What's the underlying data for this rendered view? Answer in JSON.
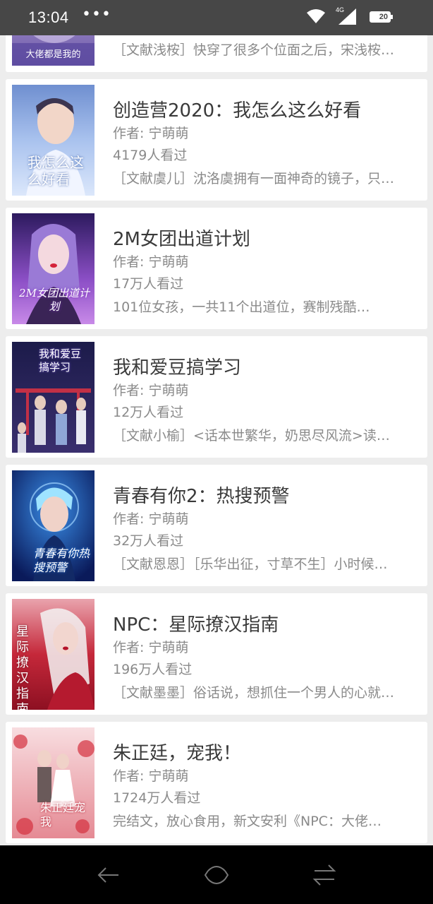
{
  "status_bar": {
    "time": "13:04",
    "dots": "•••",
    "network": "4G",
    "battery": "20"
  },
  "books": [
    {
      "cover_text": "大佬都是我的",
      "title": "",
      "author": "",
      "views": "",
      "desc": "［文献浅桉］快穿了很多个位面之后，宋浅桉…"
    },
    {
      "cover_text": "我怎么这么好看",
      "title": "创造营2020：我怎么这么好看",
      "author": "作者: 宁萌萌",
      "views": "4179人看过",
      "desc": "［文献虞儿］沈洛虞拥有一面神奇的镜子，只…"
    },
    {
      "cover_text": "2M女团出道计划",
      "title": "2M女团出道计划",
      "author": "作者: 宁萌萌",
      "views": "17万人看过",
      "desc": "101位女孩，一共11个出道位，赛制残酷…"
    },
    {
      "cover_text": "我和爱豆搞学习",
      "title": "我和爱豆搞学习",
      "author": "作者: 宁萌萌",
      "views": "12万人看过",
      "desc": "［文献小榆］<话本世繁华，奶思尽风流>读…"
    },
    {
      "cover_text": "青春有你热搜预警",
      "title": "青春有你2：热搜预警",
      "author": "作者: 宁萌萌",
      "views": "32万人看过",
      "desc": "［文献恩恩］［乐华出征，寸草不生］小时候…"
    },
    {
      "cover_text": "星际撩汉指南",
      "title": "NPC：星际撩汉指南",
      "author": "作者: 宁萌萌",
      "views": "196万人看过",
      "desc": "［文献墨墨］俗话说，想抓住一个男人的心就…"
    },
    {
      "cover_text": "朱正廷宠我",
      "title": "朱正廷，宠我！",
      "author": "作者: 宁萌萌",
      "views": "1724万人看过",
      "desc": "完结文，放心食用，新文安利《NPC：大佬…"
    }
  ],
  "colors": {
    "status_bar": "#474747",
    "background": "#ededed",
    "card": "#ffffff",
    "title_text": "#3a3a3a",
    "meta_text": "#8a8a8a",
    "nav_bar": "#000000"
  },
  "icons": {
    "status": [
      "wifi-icon",
      "signal-icon",
      "battery-icon"
    ],
    "nav": [
      "back-icon",
      "home-icon",
      "recent-apps-icon"
    ]
  }
}
